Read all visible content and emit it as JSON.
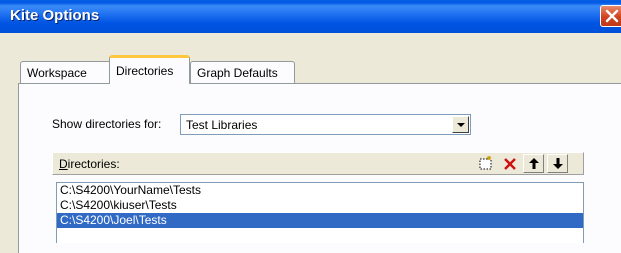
{
  "window": {
    "title": "Kite Options"
  },
  "tabs": [
    {
      "label": "Workspace",
      "active": false
    },
    {
      "label": "Directories",
      "active": true
    },
    {
      "label": "Graph Defaults",
      "active": false
    }
  ],
  "show_directories": {
    "label": "Show directories for:",
    "selected": "Test Libraries"
  },
  "directories": {
    "label_first": "D",
    "label_rest": "irectories:",
    "toolbar": [
      "new-folder-icon",
      "delete-icon",
      "move-up-icon",
      "move-down-icon"
    ],
    "items": [
      {
        "path": "C:\\S4200\\YourName\\Tests",
        "selected": false
      },
      {
        "path": "C:\\S4200\\kiuser\\Tests",
        "selected": false
      },
      {
        "path": "C:\\S4200\\Joel\\Tests",
        "selected": true
      }
    ]
  },
  "colors": {
    "titlebar": "#0054E3",
    "selection": "#316AC5",
    "active_tab_accent": "#FFC83C",
    "close_button": "#D0431E"
  }
}
